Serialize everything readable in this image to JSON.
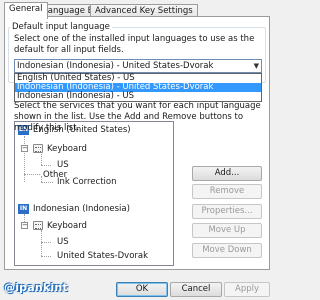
{
  "tabs": [
    {
      "label": "General",
      "active": true
    },
    {
      "label": "Language Bar",
      "active": false
    },
    {
      "label": "Advanced Key Settings",
      "active": false
    }
  ],
  "default_language": {
    "group_label": "Default input language",
    "description": "Select one of the installed input languages to use as the default for all input fields.",
    "selected_value": "Indonesian (Indonesia) - United States-Dvorak",
    "options": [
      {
        "label": "English (United States) - US",
        "selected": false
      },
      {
        "label": "Indonesian (Indonesia) - United States-Dvorak",
        "selected": true
      },
      {
        "label": "Indonesian (Indonesia) - US",
        "selected": false
      }
    ]
  },
  "installed_services": {
    "description": "Select the services that you want for each input language shown in the list. Use the Add and Remove buttons to modify this list.",
    "tree": {
      "lang1": {
        "badge": "EN",
        "label": "English (United States)"
      },
      "lang1_keyboard": "Keyboard",
      "lang1_kb_us": "US",
      "lang1_other": "Other",
      "lang1_ink": "Ink Correction",
      "lang2": {
        "badge": "IN",
        "label": "Indonesian (Indonesia)"
      },
      "lang2_keyboard": "Keyboard",
      "lang2_kb_us": "US",
      "lang2_kb_dvorak": "United States-Dvorak"
    }
  },
  "side_buttons": {
    "add": "Add...",
    "remove": "Remove",
    "properties": "Properties...",
    "move_up": "Move Up",
    "move_down": "Move Down"
  },
  "bottom_buttons": {
    "ok": "OK",
    "cancel": "Cancel",
    "apply": "Apply"
  },
  "watermark": "@ipankint",
  "icons": {
    "dropdown_arrow": "chevron-down-icon",
    "keyboard": "keyboard-icon",
    "tree_expand": "minus-icon"
  },
  "colors": {
    "selection": "#3399ff",
    "badge": "#2d6fc7",
    "watermark_outline": "#1e6ab8"
  }
}
